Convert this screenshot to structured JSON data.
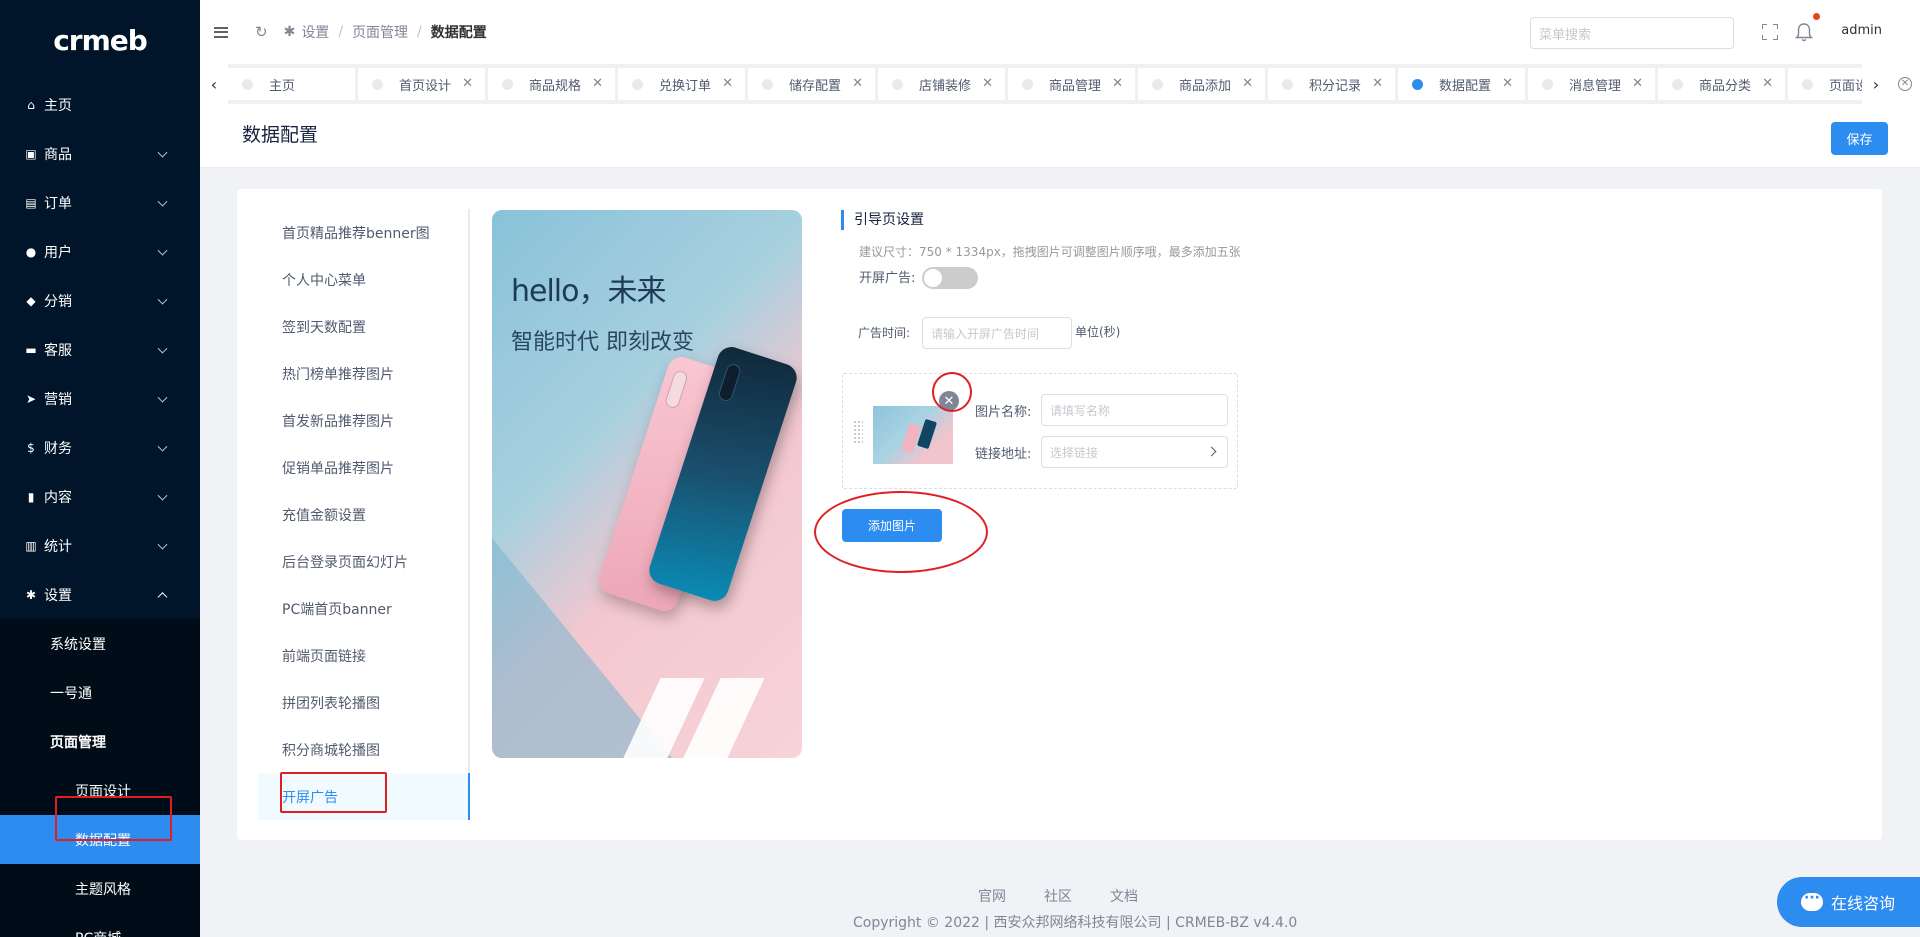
{
  "sidebar": {
    "logo": "crmeb",
    "menu": [
      {
        "label": "主页",
        "icon": "home-icon"
      },
      {
        "label": "商品",
        "icon": "shop-icon"
      },
      {
        "label": "订单",
        "icon": "cart-icon"
      },
      {
        "label": "用户",
        "icon": "user-icon"
      },
      {
        "label": "分销",
        "icon": "distribution-icon"
      },
      {
        "label": "客服",
        "icon": "chat-icon"
      },
      {
        "label": "营销",
        "icon": "send-icon"
      },
      {
        "label": "财务",
        "icon": "dollar-icon"
      },
      {
        "label": "内容",
        "icon": "book-icon"
      },
      {
        "label": "统计",
        "icon": "chart-icon"
      },
      {
        "label": "设置",
        "icon": "gear-icon"
      }
    ],
    "settings_sub": [
      "系统设置",
      "一号通",
      "页面管理"
    ],
    "page_mgmt_sub": [
      "页面设计",
      "数据配置",
      "主题风格",
      "PC商城"
    ]
  },
  "header": {
    "breadcrumb": [
      "设置",
      "页面管理",
      "数据配置"
    ],
    "search_placeholder": "菜单搜索",
    "user": "admin"
  },
  "tabs": [
    {
      "label": "主页",
      "active": false
    },
    {
      "label": "首页设计",
      "active": false
    },
    {
      "label": "商品规格",
      "active": false
    },
    {
      "label": "兑换订单",
      "active": false
    },
    {
      "label": "储存配置",
      "active": false
    },
    {
      "label": "店铺装修",
      "active": false
    },
    {
      "label": "商品管理",
      "active": false
    },
    {
      "label": "商品添加",
      "active": false
    },
    {
      "label": "积分记录",
      "active": false
    },
    {
      "label": "数据配置",
      "active": true
    },
    {
      "label": "消息管理",
      "active": false
    },
    {
      "label": "商品分类",
      "active": false
    },
    {
      "label": "页面设计",
      "active": false
    }
  ],
  "page": {
    "title": "数据配置",
    "save_label": "保存"
  },
  "leftnav": [
    "首页精品推荐benner图",
    "个人中心菜单",
    "签到天数配置",
    "热门榜单推荐图片",
    "首发新品推荐图片",
    "促销单品推荐图片",
    "充值金额设置",
    "后台登录页面幻灯片",
    "PC端首页banner",
    "前端页面链接",
    "拼团列表轮播图",
    "积分商城轮播图",
    "开屏广告"
  ],
  "preview": {
    "hello": "hello，未来",
    "slogan": "智能时代 即刻改变"
  },
  "config": {
    "section_title": "引导页设置",
    "hint": "建议尺寸：750 * 1334px，拖拽图片可调整图片顺序哦，最多添加五张",
    "switch_label": "开屏广告:",
    "switch_on": false,
    "time_label": "广告时间:",
    "time_placeholder": "请输入开屏广告时间",
    "time_unit": "单位(秒)",
    "image_name_label": "图片名称:",
    "image_name_placeholder": "请填写名称",
    "link_label": "链接地址:",
    "link_placeholder": "选择链接",
    "add_button": "添加图片"
  },
  "footer": {
    "links": [
      "官网",
      "社区",
      "文档"
    ],
    "copyright": "Copyright © 2022 | 西安众邦网络科技有限公司 | CRMEB-BZ v4.4.0"
  },
  "chat": {
    "label": "在线咨询"
  },
  "colors": {
    "primary": "#2d8cf0",
    "sidebar_bg": "#001529",
    "highlight": "#e02020"
  }
}
